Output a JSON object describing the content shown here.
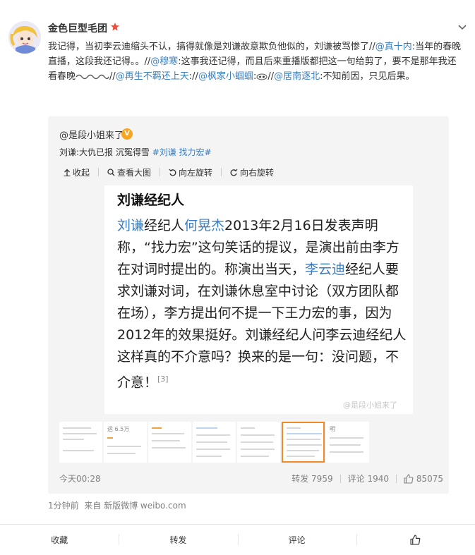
{
  "post": {
    "author": "金色巨型毛团",
    "text_main": "我记得，当初李云迪缩头不认，搞得就像是刘谦故意欺负他似的，刘谦被骂惨了//",
    "mention1": "@真十内",
    "text_after1": ":当年的春晚直播，这段我还记得。。//",
    "mention2": "@穆寒",
    "text_after2": ":这事我还记得，而且后来重播版都把这一句给剪了，要不是那年我还看春晚",
    "text_after2b": "//",
    "mention3": "@再生不羁还上天",
    "text_after3": "://",
    "mention4": "@枫家小蝈蝈",
    "text_after4": ":",
    "text_after4b": "//",
    "mention5": "@居南逐北",
    "text_after5": ":不知前因，只见后果。",
    "time": "1分钟前",
    "source": "来自 新版微博 weibo.com"
  },
  "repost": {
    "author": "@是段小姐来了",
    "text_prefix": "刘谦:大仇已报 沉冤得雪 ",
    "tags": "#刘谦 找力宏#",
    "tools": {
      "collapse": "收起",
      "view_large": "查看大图",
      "rotate_left": "向左旋转",
      "rotate_right": "向右旋转"
    },
    "photo": {
      "title": "刘谦经纪人",
      "p1": "刘谦",
      "p2": "经纪人",
      "p3": "何晃杰",
      "p4": "2013年2月16日发表声明称，“找力宏”这句笑话的提议，是演出前由李方在对词时提出的。称演出当天，",
      "p5": "李云迪",
      "p6": "经纪人要求刘谦对词，在刘谦休息室中讨论（双方团队都在场），李方提出何不提一下王力宏的事，因为2012年的效果挺好。刘谦经纪人问李云迪经纪人这样真的不介意吗？换来的是一句：没问题，不介意！",
      "ref": "[3]",
      "watermark": "@是段小姐来了"
    },
    "thumbs": {
      "t2": "运 6.5万",
      "t9": "明"
    },
    "time": "今天00:28",
    "repost_label": "转发",
    "repost_count": "7959",
    "comment_label": "评论",
    "comment_count": "1940",
    "like_count": "85075"
  },
  "actions": {
    "favorite": "收藏",
    "repost": "转发",
    "comment": "评论"
  },
  "colors": {
    "link": "#3a7ec2",
    "verify": "#e8523f",
    "badge": "#f5a623",
    "thumb_active": "#f08a24"
  }
}
